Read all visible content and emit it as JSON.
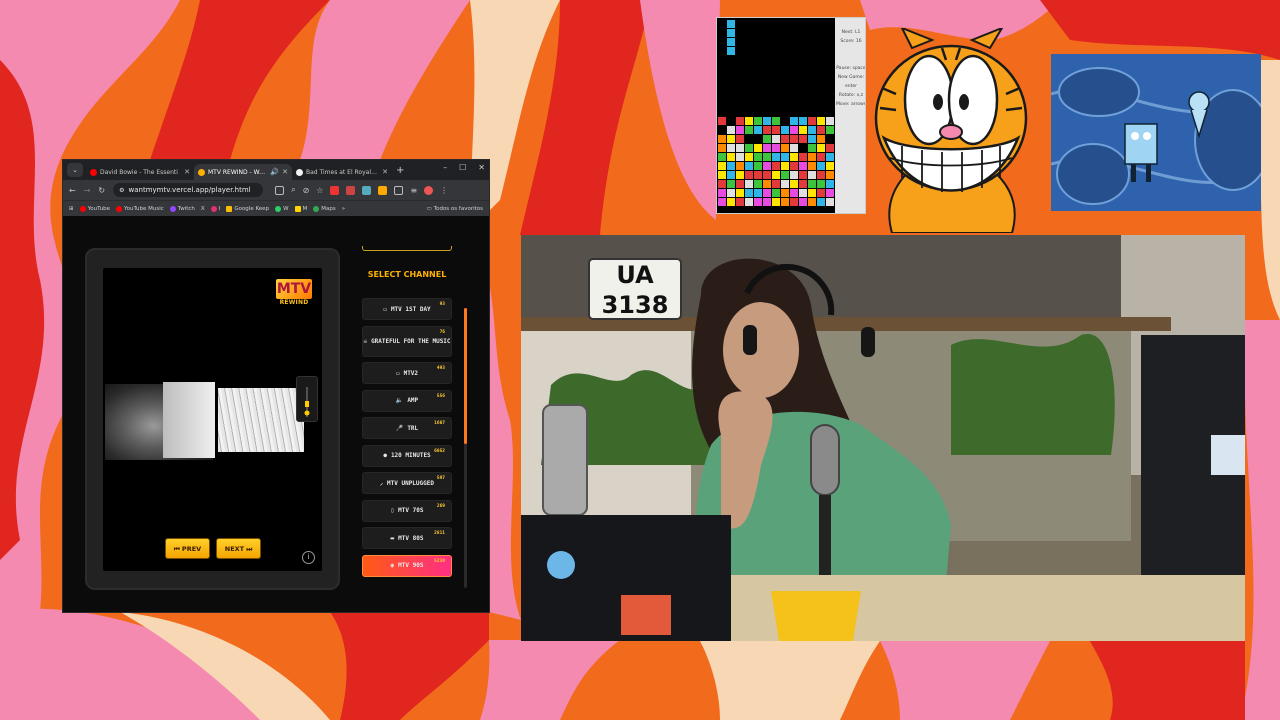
{
  "colors": {
    "bg_orange": "#f26a1b",
    "bg_pink": "#f48ab0",
    "bg_red": "#e0261f",
    "bg_cream": "#f8d7b5",
    "accent": "#ffb100",
    "active_start": "#ff5a14",
    "active_end": "#ff2f85"
  },
  "browser": {
    "tabs": [
      {
        "title": "David Bowie - The Essenti",
        "icon": "youtube-icon",
        "color": "#ff0000",
        "active": false
      },
      {
        "title": "MTV REWIND - Watc",
        "icon": "mtv-icon",
        "color": "#ffb100",
        "active": true
      },
      {
        "title": "Bad Times at El Royale - G",
        "icon": "google-icon",
        "color": "#4285f4",
        "active": false
      }
    ],
    "address": "wantmymtv.vercel.app/player.html",
    "bookmarks": [
      {
        "label": "YouTube",
        "color": "#ff0000"
      },
      {
        "label": "YouTube Music",
        "color": "#ff0000"
      },
      {
        "label": "Twitch",
        "color": "#9146ff"
      },
      {
        "label": "X",
        "color": "#ffffff"
      },
      {
        "label": "I",
        "color": "#e1306c"
      },
      {
        "label": "Google Keep",
        "color": "#fbbc04"
      },
      {
        "label": "W",
        "color": "#25d366"
      },
      {
        "label": "M",
        "color": "#ffd600"
      },
      {
        "label": "Maps",
        "color": "#34a853"
      }
    ],
    "bookmarks_more": "»",
    "bookmarks_all": "Todos os favoritos"
  },
  "player": {
    "logo_main": "MTV",
    "logo_sub": "REWIND",
    "prev_label": "⏮ PREV",
    "next_label": "NEXT ⏭",
    "info_label": "i"
  },
  "channels": {
    "heading": "SELECT CHANNEL",
    "items": [
      {
        "label": "MTV 1ST DAY",
        "count": "93",
        "icon": "tv-icon",
        "glyph": "▭"
      },
      {
        "label": "GRATEFUL FOR THE MUSIC",
        "count": "76",
        "icon": "skull-icon",
        "glyph": "☠"
      },
      {
        "label": "MTV2",
        "count": "493",
        "icon": "tv-icon",
        "glyph": "▭"
      },
      {
        "label": "AMP",
        "count": "556",
        "icon": "speaker-icon",
        "glyph": "🔈"
      },
      {
        "label": "TRL",
        "count": "1607",
        "icon": "microphone-icon",
        "glyph": "🎤"
      },
      {
        "label": "120 MINUTES",
        "count": "6052",
        "icon": "dot-icon",
        "glyph": "●"
      },
      {
        "label": "MTV UNPLUGGED",
        "count": "597",
        "icon": "plug-icon",
        "glyph": "⸝"
      },
      {
        "label": "MTV 70S",
        "count": "269",
        "icon": "phone-icon",
        "glyph": "▯"
      },
      {
        "label": "MTV 80S",
        "count": "2811",
        "icon": "cassette-icon",
        "glyph": "▬"
      },
      {
        "label": "MTV 90S",
        "count": "5230",
        "icon": "disc-icon",
        "glyph": "◉"
      }
    ],
    "active_index": 9
  },
  "tetris": {
    "next_label": "Next: L1",
    "score_label": "Score: 16",
    "pause_label": "Pause: space",
    "new_game_label": "New Game: enter",
    "rotate_label": "Rotate: x,z",
    "move_label": "Move: arrows"
  },
  "webcam": {
    "plate_line1": "UA",
    "plate_line2": "3138"
  }
}
